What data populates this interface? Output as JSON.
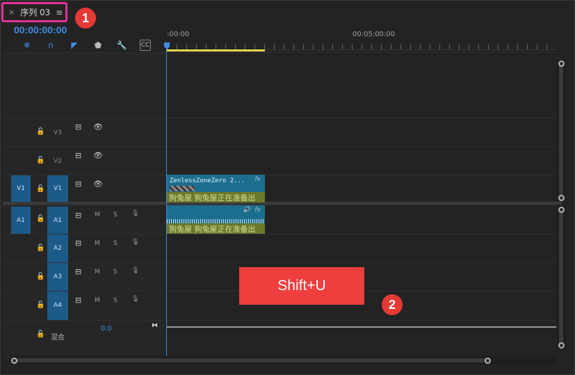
{
  "panel": {
    "close_glyph": "×",
    "title": "序列 03",
    "menu_glyph": "≡"
  },
  "annotations": {
    "badge1": "1",
    "badge2": "2",
    "shortcut": "Shift+U"
  },
  "timecode": "00:00:00:00",
  "toolbar": [
    {
      "icon": "snap-icon",
      "glyph": "❄"
    },
    {
      "icon": "linked-selection-icon",
      "glyph": "∩"
    },
    {
      "icon": "add-marker-icon",
      "glyph": "◤"
    },
    {
      "icon": "marker-icon",
      "glyph": "⬟"
    },
    {
      "icon": "wrench-icon",
      "glyph": "🔧"
    },
    {
      "icon": "captions-icon",
      "glyph": "CC"
    }
  ],
  "ruler": {
    "start": ":00:00",
    "mark": "00:05:00:00"
  },
  "tracks": {
    "v3": {
      "name": "V3"
    },
    "v2": {
      "name": "V2"
    },
    "v1": {
      "name": "V1",
      "source": "V1"
    },
    "a1": {
      "name": "A1",
      "source": "A1"
    },
    "a2": {
      "name": "A2"
    },
    "a3": {
      "name": "A3"
    },
    "a4": {
      "name": "A4"
    },
    "audio_m": "M",
    "audio_s": "S"
  },
  "mix": {
    "label": "混合",
    "value": "0.0"
  },
  "clips": {
    "video": {
      "name": "ZenlessZoneZero 2...",
      "fx": "fx",
      "label": "狗兔屋 狗兔屋正在准备出"
    },
    "audio": {
      "fx": "fx",
      "label": "狗兔屋 狗兔屋正在准备出"
    }
  }
}
